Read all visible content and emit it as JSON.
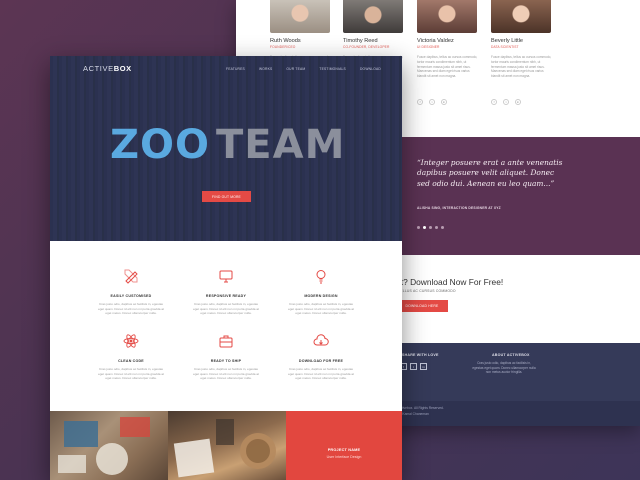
{
  "team": [
    {
      "name": "Ruth Woods",
      "role": "FOUNDER/CEO",
      "desc": "Fusce dapibus, tellus ac cursus commodo, tortor mauris condimentum nibh, ut fermentum massa justo sit amet risus. Maecenas sed diam eget risus varius blandit sit amet non magna."
    },
    {
      "name": "Timothy Reed",
      "role": "CO-FOUNDER, DEVELOPER",
      "desc": "Fusce dapibus, tellus ac cursus commodo, tortor mauris condimentum nibh, ut fermentum massa justo sit amet risus. Maecenas sed diam eget risus varius blandit sit amet non magna."
    },
    {
      "name": "Victoria Valdez",
      "role": "UI DESIGNER",
      "desc": "Fusce dapibus, tellus ac cursus commodo, tortor mauris condimentum nibh, ut fermentum massa justo sit amet risus. Maecenas sed diam eget risus varius blandit sit amet non magna."
    },
    {
      "name": "Beverly Little",
      "role": "DATA SCIENTIST",
      "desc": "Fusce dapibus, tellus ac cursus commodo, tortor mauris condimentum nibh, ut fermentum massa justo sit amet risus. Maecenas sed diam eget risus varius blandit sit amet non magna."
    }
  ],
  "quote": {
    "text": "“Integer posuere erat a ante venenatis dapibus posuere velit aliquet. Donec sed odio dui. Aenean eu leo quam...”",
    "author": "ALISHA SING, INTERACTION DESIGNER AT XYZ"
  },
  "download": {
    "title": "rt? Download Now For Free!",
    "subtitle": "TELLUS AC CURSUS COMMODO",
    "button": "DOWNLOAD HERE"
  },
  "footer": {
    "share_label": "SHARE WITH LOVE",
    "share_icons": [
      "f",
      "t",
      "in"
    ],
    "about_title": "ABOUT ACTIVEBOX",
    "about_text": "Cras justo odio, dapibus ac facilisis in, egestas eget quam. Donec ullamcorper nulla non metus auctor fringilla.",
    "copyright_1": "Activebox. All Rights Reserved.",
    "copyright_2": "by Kamal Chaneman"
  },
  "header": {
    "brand_main": "ACTIVE",
    "brand_bold": "BOX",
    "nav": [
      "FEATURES",
      "WORKS",
      "OUR TEAM",
      "TESTIMONIALS",
      "DOWNLOAD"
    ],
    "hero_title_a": "ZOO",
    "hero_title_b": "TEAM",
    "hero_button": "FIND OUT MORE"
  },
  "features": [
    {
      "icon": "pencil-ruler-icon",
      "title": "EASILY CUSTOMISED",
      "desc": "Cras justo odio, dapibus ac facilisis in, egestas eget quam. Donec id elit non mi porta gravida at eget metus. Donec ullamcorper nulla."
    },
    {
      "icon": "monitor-icon",
      "title": "RESPONSIVE READY",
      "desc": "Cras justo odio, dapibus ac facilisis in, egestas eget quam. Donec id elit non mi porta gravida at eget metus. Donec ullamcorper nulla."
    },
    {
      "icon": "lightbulb-icon",
      "title": "MODERN DESIGN",
      "desc": "Cras justo odio, dapibus ac facilisis in, egestas eget quam. Donec id elit non mi porta gravida at eget metus. Donec ullamcorper nulla."
    },
    {
      "icon": "atom-icon",
      "title": "CLEAN CODE",
      "desc": "Cras justo odio, dapibus ac facilisis in, egestas eget quam. Donec id elit non mi porta gravida at eget metus. Donec ullamcorper nulla."
    },
    {
      "icon": "briefcase-icon",
      "title": "READY TO SHIP",
      "desc": "Cras justo odio, dapibus ac facilisis in, egestas eget quam. Donec id elit non mi porta gravida at eget metus. Donec ullamcorper nulla."
    },
    {
      "icon": "cloud-download-icon",
      "title": "DOWNLOAD FOR FREE",
      "desc": "Cras justo odio, dapibus ac facilisis in, egestas eget quam. Donec id elit non mi porta gravida at eget metus. Donec ullamcorper nulla."
    }
  ],
  "portfolio": {
    "project_name": "PROJECT NAME",
    "project_category": "User Interface Design"
  },
  "colors": {
    "accent": "#e44a45",
    "hero_bg": "#2b3150",
    "quote_bg": "#5a3253",
    "footer_bg": "#353a59",
    "logo_blue": "#5aa9e0",
    "logo_gray": "#8b8f9c"
  }
}
